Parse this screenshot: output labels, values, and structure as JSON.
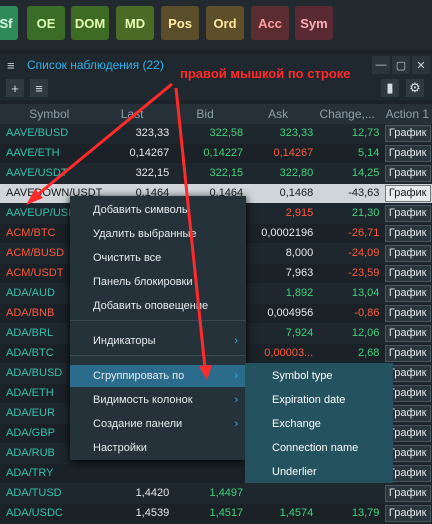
{
  "toolbar": {
    "buttons": [
      {
        "label": "Sf",
        "bg": "#2f8a59",
        "fg": "#d6ffe6"
      },
      {
        "label": "OE",
        "bg": "#3a6b27",
        "fg": "#d8ffb0"
      },
      {
        "label": "DOM",
        "bg": "#3d6b24",
        "fg": "#e4ffb2"
      },
      {
        "label": "MD",
        "bg": "#4a6b25",
        "fg": "#e6ffb8"
      },
      {
        "label": "Pos",
        "bg": "#5a4e2a",
        "fg": "#ffeaa6"
      },
      {
        "label": "Ord",
        "bg": "#5c4f2a",
        "fg": "#ffe5a0"
      },
      {
        "label": "Acc",
        "bg": "#5a2d30",
        "fg": "#ff9ca0"
      },
      {
        "label": "Sym",
        "bg": "#5a2a34",
        "fg": "#ffb0bd"
      }
    ]
  },
  "panel": {
    "title": "Список наблюдения (22)",
    "min_label": "—",
    "max_label": "▢",
    "close_label": "✕"
  },
  "icons": {
    "add": "+",
    "list": "≡"
  },
  "annotation": "правой мышкой по строке",
  "columns": [
    "Symbol",
    "Last",
    "Bid",
    "Ask",
    "Change,...",
    "Action 1"
  ],
  "rows": [
    {
      "sym": "AAVE/BUSD",
      "last": "323,33",
      "bid": "322,58",
      "ask": "323,33",
      "chg": "12,73",
      "act": "График",
      "sym_color": "#35c1ad",
      "bid_color": "#3fd27c",
      "ask_color": "#3fd27c",
      "chg_color": "#3fd27c"
    },
    {
      "sym": "AAVE/ETH",
      "last": "0,14267",
      "bid": "0,14227",
      "ask": "0,14267",
      "chg": "5,14",
      "act": "График",
      "sym_color": "#35c1ad",
      "bid_color": "#3fd27c",
      "ask_color": "#ff5a3d",
      "chg_color": "#3fd27c"
    },
    {
      "sym": "AAVE/USDT",
      "last": "322,15",
      "bid": "322,15",
      "ask": "322,80",
      "chg": "14,25",
      "act": "График",
      "sym_color": "#35c1ad",
      "bid_color": "#3fd27c",
      "ask_color": "#3fd27c",
      "chg_color": "#3fd27c"
    },
    {
      "sym": "AAVEDOWN/USDT",
      "last": "0,1464",
      "bid": "0,1464",
      "ask": "0,1468",
      "chg": "-43,63",
      "act": "График",
      "sym_color": "#1a1a1a",
      "bid_color": "#1a1a1a",
      "ask_color": "#1a1a1a",
      "chg_color": "#1a1a1a",
      "selected": true
    },
    {
      "sym": "AAVEUP/USD",
      "last": "",
      "bid": "",
      "ask": "2,915",
      "chg": "21,30",
      "act": "График",
      "sym_color": "#35c1ad",
      "bid_color": "#3fd27c",
      "ask_color": "#ff5a3d",
      "chg_color": "#3fd27c"
    },
    {
      "sym": "ACM/BTC",
      "last": "",
      "bid": "",
      "ask": "0,0002196",
      "chg": "-26,71",
      "act": "График",
      "sym_color": "#ff5a3d",
      "bid_color": "#3fd27c",
      "ask_color": "#e6e9eb",
      "chg_color": "#ff5a3d"
    },
    {
      "sym": "ACM/BUSD",
      "last": "",
      "bid": "",
      "ask": "8,000",
      "chg": "-24,09",
      "act": "График",
      "sym_color": "#ff5a3d",
      "bid_color": "#3fd27c",
      "ask_color": "#e6e9eb",
      "chg_color": "#ff5a3d"
    },
    {
      "sym": "ACM/USDT",
      "last": "",
      "bid": "",
      "ask": "7,963",
      "chg": "-23,59",
      "act": "График",
      "sym_color": "#ff5a3d",
      "bid_color": "#3fd27c",
      "ask_color": "#e6e9eb",
      "chg_color": "#ff5a3d"
    },
    {
      "sym": "ADA/AUD",
      "last": "",
      "bid": "",
      "ask": "1,892",
      "chg": "13,04",
      "act": "График",
      "sym_color": "#35c1ad",
      "bid_color": "#3fd27c",
      "ask_color": "#3fd27c",
      "chg_color": "#3fd27c"
    },
    {
      "sym": "ADA/BNB",
      "last": "",
      "bid": "",
      "ask": "0,004956",
      "chg": "-0,86",
      "act": "График",
      "sym_color": "#ff5a3d",
      "bid_color": "#3fd27c",
      "ask_color": "#e6e9eb",
      "chg_color": "#ff5a3d"
    },
    {
      "sym": "ADA/BRL",
      "last": "",
      "bid": "",
      "ask": "7,924",
      "chg": "12,06",
      "act": "График",
      "sym_color": "#35c1ad",
      "bid_color": "#3fd27c",
      "ask_color": "#3fd27c",
      "chg_color": "#3fd27c"
    },
    {
      "sym": "ADA/BTC",
      "last": "",
      "bid": "",
      "ask": "0,00003...",
      "chg": "2,68",
      "act": "График",
      "sym_color": "#35c1ad",
      "bid_color": "#3fd27c",
      "ask_color": "#ff5a3d",
      "chg_color": "#3fd27c"
    },
    {
      "sym": "ADA/BUSD",
      "last": "",
      "bid": "",
      "ask": "1,4543",
      "chg": "13,55",
      "act": "График",
      "sym_color": "#35c1ad",
      "bid_color": "#3fd27c",
      "ask_color": "#3fd27c",
      "chg_color": "#3fd27c"
    },
    {
      "sym": "ADA/ETH",
      "last": "",
      "bid": "",
      "ask": "",
      "chg": "",
      "act": "График",
      "sym_color": "#35c1ad",
      "bid_color": "#3fd27c",
      "ask_color": "#3fd27c",
      "chg_color": "#3fd27c"
    },
    {
      "sym": "ADA/EUR",
      "last": "",
      "bid": "",
      "ask": "",
      "chg": "",
      "act": "График",
      "sym_color": "#35c1ad",
      "bid_color": "#3fd27c",
      "ask_color": "#3fd27c",
      "chg_color": "#3fd27c"
    },
    {
      "sym": "ADA/GBP",
      "last": "",
      "bid": "",
      "ask": "",
      "chg": "",
      "act": "График",
      "sym_color": "#35c1ad",
      "bid_color": "#3fd27c",
      "ask_color": "#3fd27c",
      "chg_color": "#3fd27c"
    },
    {
      "sym": "ADA/RUB",
      "last": "",
      "bid": "",
      "ask": "",
      "chg": "",
      "act": "График",
      "sym_color": "#35c1ad",
      "bid_color": "#3fd27c",
      "ask_color": "#3fd27c",
      "chg_color": "#3fd27c"
    },
    {
      "sym": "ADA/TRY",
      "last": "",
      "bid": "",
      "ask": "",
      "chg": "",
      "act": "График",
      "sym_color": "#35c1ad",
      "bid_color": "#3fd27c",
      "ask_color": "#3fd27c",
      "chg_color": "#3fd27c"
    },
    {
      "sym": "ADA/TUSD",
      "last": "1,4420",
      "bid": "1,4497",
      "ask": "",
      "chg": "",
      "act": "График",
      "sym_color": "#35c1ad",
      "bid_color": "#3fd27c",
      "ask_color": "#3fd27c",
      "chg_color": "#3fd27c"
    },
    {
      "sym": "ADA/USDC",
      "last": "1,4539",
      "bid": "1,4517",
      "ask": "1,4574",
      "chg": "13,79",
      "act": "График",
      "sym_color": "#35c1ad",
      "bid_color": "#3fd27c",
      "ask_color": "#3fd27c",
      "chg_color": "#3fd27c"
    }
  ],
  "context_menu": {
    "items": [
      {
        "label": "Добавить символы"
      },
      {
        "label": "Удалить выбранные"
      },
      {
        "label": "Очистить все"
      },
      {
        "label": "Панель блокировки"
      },
      {
        "label": "Добавить оповещение"
      },
      {
        "label": "Индикаторы",
        "sub": true
      },
      {
        "label": "Сгруппировать по",
        "sub": true,
        "highlighted": true
      },
      {
        "label": "Видимость колонок",
        "sub": true
      },
      {
        "label": "Создание панели",
        "sub": true
      },
      {
        "label": "Настройки"
      }
    ]
  },
  "submenu": {
    "items": [
      "Symbol type",
      "Expiration date",
      "Exchange",
      "Connection name",
      "Underlier"
    ]
  }
}
